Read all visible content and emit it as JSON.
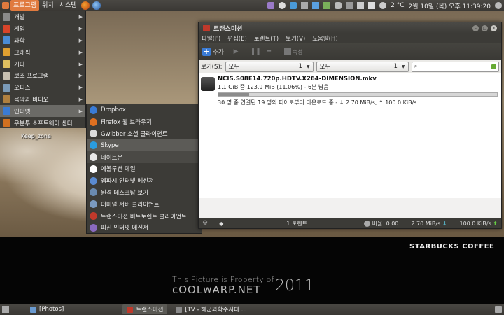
{
  "top_panel": {
    "menus": [
      "프로그램",
      "위치",
      "시스템"
    ],
    "temperature": "2 °C",
    "clock": "2월 10일 (목) 오후 11:39:20"
  },
  "apps_menu": {
    "items": [
      {
        "label": "개발",
        "icon": "dev-icon",
        "color": "#8a8a8a"
      },
      {
        "label": "게임",
        "icon": "game-icon",
        "color": "#d8442a"
      },
      {
        "label": "과학",
        "icon": "science-icon",
        "color": "#4a8cd6"
      },
      {
        "label": "그래픽",
        "icon": "graphics-icon",
        "color": "#e0a030"
      },
      {
        "label": "기타",
        "icon": "misc-icon",
        "color": "#e0c060"
      },
      {
        "label": "보조 프로그램",
        "icon": "accessories-icon",
        "color": "#c8c0b0"
      },
      {
        "label": "오피스",
        "icon": "office-icon",
        "color": "#7a9ab8"
      },
      {
        "label": "음악과 비디오",
        "icon": "media-icon",
        "color": "#b08040"
      },
      {
        "label": "인터넷",
        "icon": "internet-icon",
        "color": "#3a7bd5"
      },
      {
        "label": "우분투 소프트웨어 센터",
        "icon": "software-center-icon",
        "color": "#d07020"
      }
    ]
  },
  "internet_submenu": {
    "items": [
      {
        "label": "Dropbox",
        "icon": "dropbox-icon",
        "color": "#3a7bd5"
      },
      {
        "label": "Firefox 웹 브라우저",
        "icon": "firefox-icon",
        "color": "#e07020"
      },
      {
        "label": "Gwibber 소셜 클라이언트",
        "icon": "gwibber-icon",
        "color": "#dddddd"
      },
      {
        "label": "Skype",
        "icon": "skype-icon",
        "color": "#2a9ce0"
      },
      {
        "label": "네이트온",
        "icon": "nateon-icon",
        "color": "#e8e8e8"
      },
      {
        "label": "에볼루션 메일",
        "icon": "evolution-icon",
        "color": "#ffffff"
      },
      {
        "label": "엠파시 인터넷 메신저",
        "icon": "empathy-icon",
        "color": "#5a8ad0"
      },
      {
        "label": "원격 데스크탑 보기",
        "icon": "remote-desktop-icon",
        "color": "#6a8ab0"
      },
      {
        "label": "터미널 서버 클라이언트",
        "icon": "terminal-server-icon",
        "color": "#7a9ac0"
      },
      {
        "label": "트랜스미션 비트토렌트 클라이언트",
        "icon": "transmission-icon",
        "color": "#c0392b"
      },
      {
        "label": "피진 인터넷 메신저",
        "icon": "pidgin-icon",
        "color": "#8a6ac0"
      }
    ]
  },
  "desktop": {
    "label": "Keep_zone"
  },
  "transmission": {
    "title": "트랜스미션",
    "menu": [
      "파일(F)",
      "편집(E)",
      "토렌트(T)",
      "보기(V)",
      "도움말(H)"
    ],
    "toolbar": {
      "add": "추가",
      "props": "속성"
    },
    "filter": {
      "label": "보기(S):",
      "combo1": {
        "value": "모두",
        "count": "1"
      },
      "combo2": {
        "value": "모두",
        "count": "1"
      }
    },
    "torrent": {
      "name": "NCIS.S08E14.720p.HDTV.X264-DIMENSION.mkv",
      "info": "1.1 GiB 중 123.9 MiB (11.06%) - 6분 남음",
      "progress": 0.1106,
      "status": "30 명 중 연결된 19 명의 피어로부터 다운로드 중 - ↓ 2.70 MiB/s, ↑ 100.0 KiB/s"
    },
    "statusbar": {
      "count": "1 토렌트",
      "ratio": "비율: 0.00",
      "down": "2.70 MiB/s",
      "up": "100.0 KiB/s"
    }
  },
  "wallpaper": {
    "brand": "STARBUCKS COFFEE",
    "line1": "This Picture is Property of",
    "line2": "cOOLwARP.NET",
    "year": "2011"
  },
  "bottom_panel": {
    "tasks": [
      {
        "label": "[Photos]",
        "active": false
      },
      {
        "label": "트랜스미션",
        "active": true
      },
      {
        "label": "[TV - 해군과학수사대 ...",
        "active": false
      }
    ]
  },
  "colors": {
    "accent": "#e07a3e",
    "panel": "#3c3b37"
  }
}
